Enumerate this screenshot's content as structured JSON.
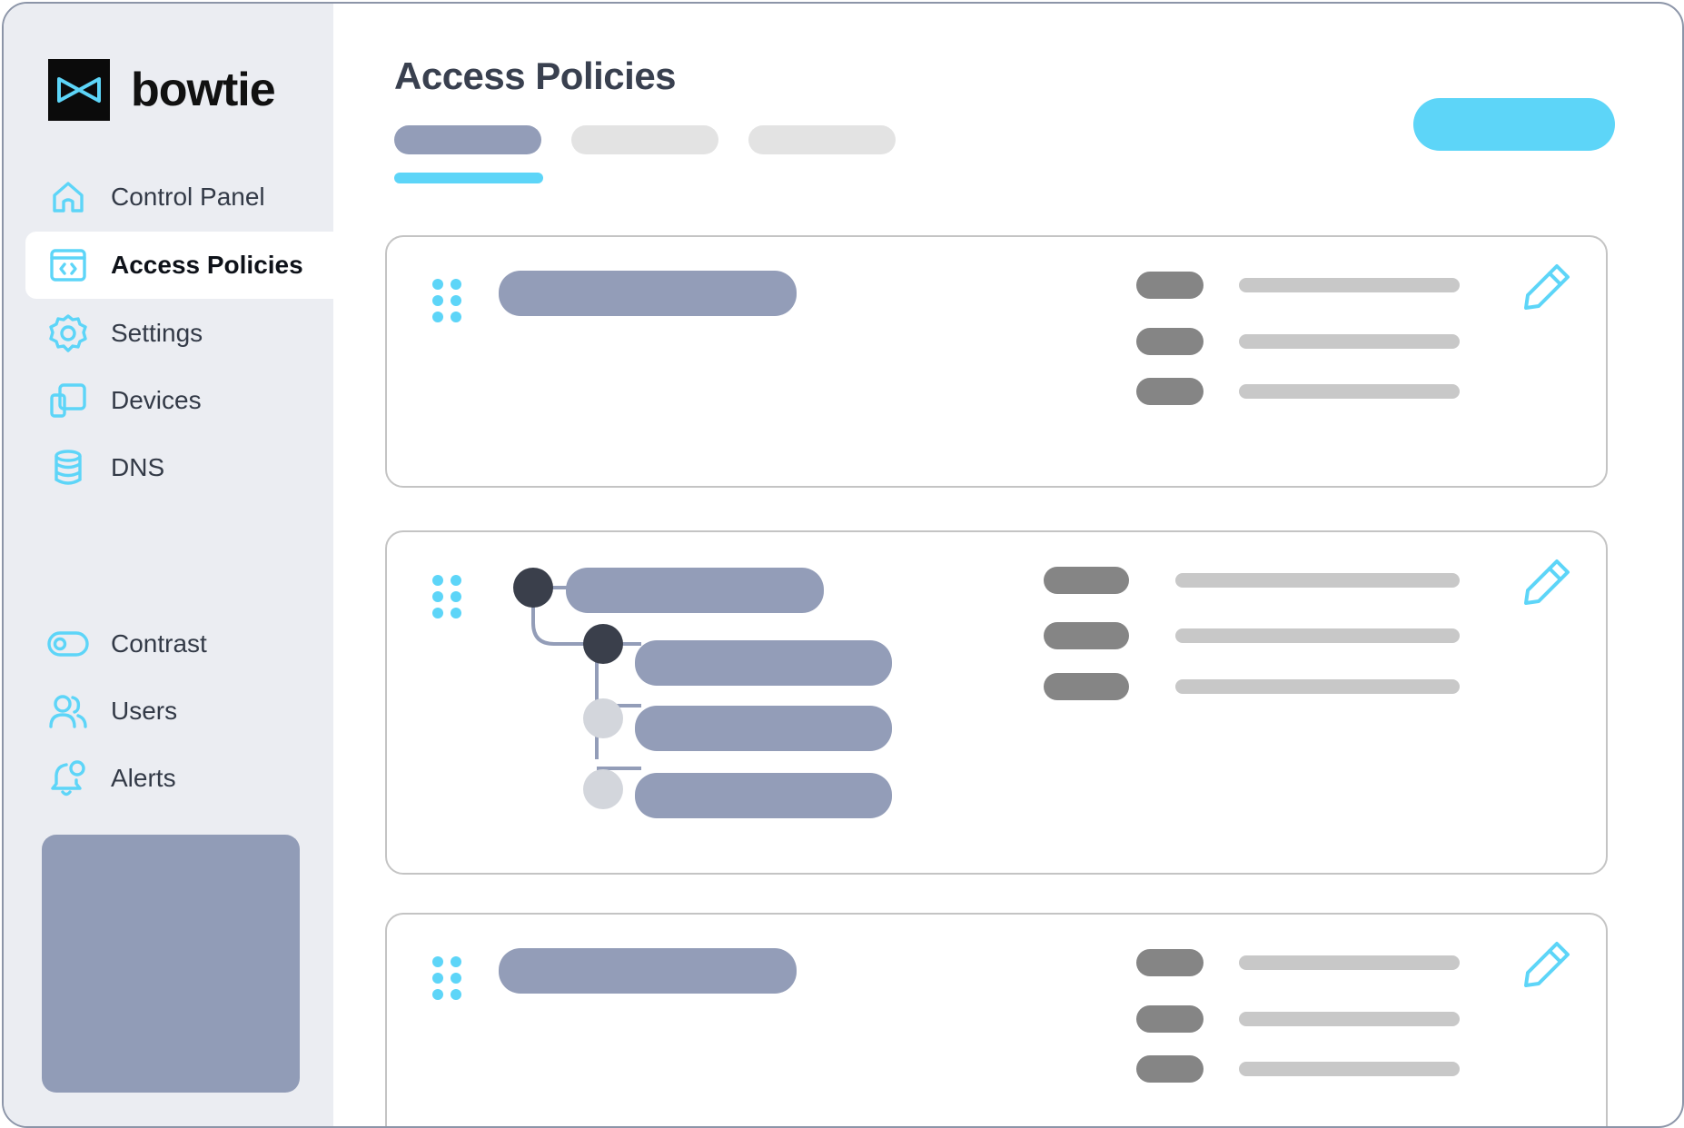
{
  "brand": {
    "name": "bowtie",
    "logo_icon": "bowtie-logo-icon",
    "accent": "#5dd5f8"
  },
  "sidebar": {
    "items": [
      {
        "label": "Control Panel",
        "icon": "home-icon"
      },
      {
        "label": "Access Policies",
        "icon": "code-window-icon",
        "active": true
      },
      {
        "label": "Settings",
        "icon": "gear-icon"
      },
      {
        "label": "Devices",
        "icon": "devices-icon"
      },
      {
        "label": "DNS",
        "icon": "database-icon"
      },
      {
        "label": "Contrast",
        "icon": "toggle-icon"
      },
      {
        "label": "Users",
        "icon": "users-icon"
      },
      {
        "label": "Alerts",
        "icon": "bell-icon"
      }
    ]
  },
  "main": {
    "title": "Access Policies",
    "tabs_count": 3,
    "active_tab": 1,
    "policies_count": 3
  },
  "colors": {
    "placeholder_pill": "#939db8",
    "tag_pill": "#858585",
    "line_pill": "#c8c8c8",
    "node_dark": "#3a3f4b",
    "node_light": "#d3d6dc"
  }
}
